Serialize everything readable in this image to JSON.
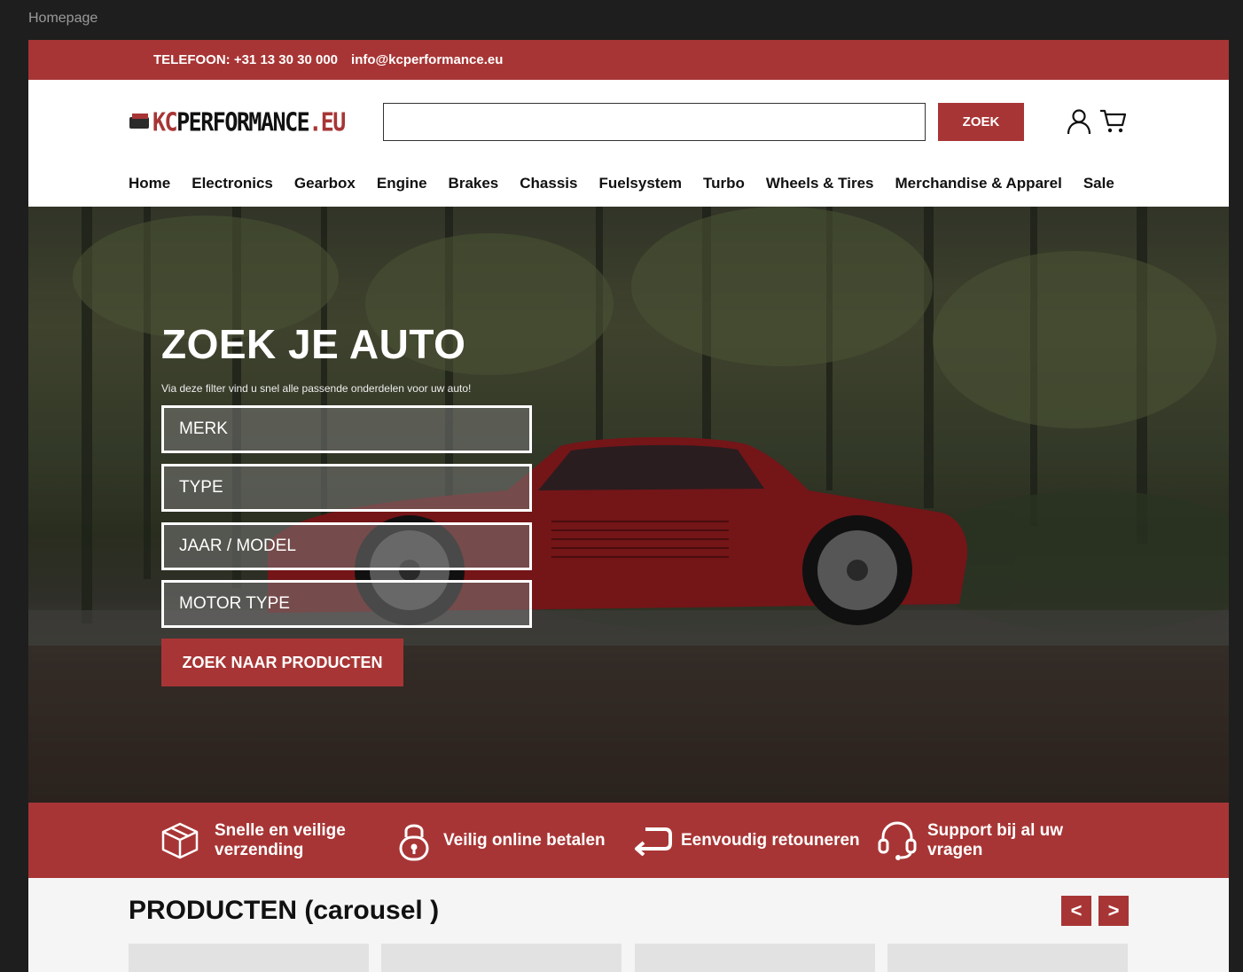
{
  "frame_label": "Homepage",
  "topbar": {
    "phone": "TELEFOON: +31 13 30 30 000",
    "email": "info@kcperformance.eu"
  },
  "header": {
    "logo": {
      "kc": "KC",
      "perf": "PERFORMANCE",
      "eu": ".EU"
    },
    "search_value": "",
    "search_button": "ZOEK"
  },
  "nav": [
    "Home",
    "Electronics",
    "Gearbox",
    "Engine",
    "Brakes",
    "Chassis",
    "Fuelsystem",
    "Turbo",
    "Wheels & Tires",
    "Merchandise & Apparel",
    "Sale"
  ],
  "hero": {
    "title": "ZOEK JE AUTO",
    "subtitle": "Via deze filter vind u snel alle passende onderdelen voor uw auto!",
    "filters": [
      "MERK",
      "TYPE",
      "JAAR / MODEL",
      "MOTOR TYPE"
    ],
    "button": "ZOEK NAAR PRODUCTEN"
  },
  "features": [
    {
      "icon": "box-icon",
      "text": "Snelle en veilige verzending"
    },
    {
      "icon": "lock-icon",
      "text": "Veilig online betalen"
    },
    {
      "icon": "return-arrow-icon",
      "text": "Eenvoudig retouneren"
    },
    {
      "icon": "headset-icon",
      "text": "Support bij al uw vragen"
    }
  ],
  "products": {
    "title": "PRODUCTEN (carousel )",
    "prev": "<",
    "next": ">"
  },
  "colors": {
    "brand": "#a83535",
    "dark": "#1e1e1e"
  }
}
